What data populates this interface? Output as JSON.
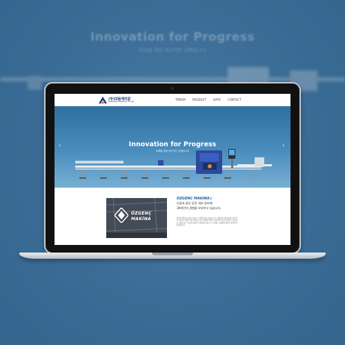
{
  "background": {
    "title": "Innovation for Progress",
    "subtitle": "미래를 위한 혁신적인 선택입니다"
  },
  "site": {
    "logo": {
      "name": "(주)대동케미칼",
      "sub": "DAEDONG CHEMICAL CO.,LTD."
    },
    "nav": [
      "TRBUM",
      "PRODUCT",
      "DATA",
      "CONTACT"
    ],
    "hero": {
      "title": "Innovation for Progress",
      "subtitle": "미래를 위한 혁신적인 선택입니다",
      "prev_icon": "chevron-left-icon",
      "next_icon": "chevron-right-icon"
    },
    "company": {
      "image_brand_line1": "ÖZGENÇ",
      "image_brand_line2": "MAKİNA",
      "title_highlight": "OZGENC MAKINA",
      "title_suffix": "는",
      "line1": "다음과 같은 등로 개조 장비에",
      "line2": "30여년의 경험을 보유하고 있습니다.",
      "body": "튜빙가 벤딩기, 파이 프닝기, 디지털 파이 프커팅 모든 관련설비 계수를 제 조할 뿐 이 아니라 다양한 에스 파이프 가공 설비와 파이프 성형 장비 등을 공급하고 있습니다. 업계 최고 수준의 품질과 기술력을 바탕으로 국내외 고객에게 최적의 솔루션을 제공합니다."
    }
  }
}
